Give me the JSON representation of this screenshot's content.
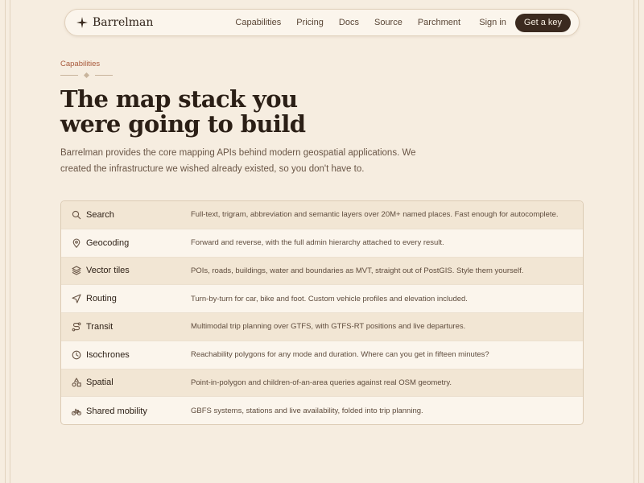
{
  "nav": {
    "brand": "Barrelman",
    "links": [
      "Capabilities",
      "Pricing",
      "Docs",
      "Source",
      "Parchment"
    ],
    "signin": "Sign in",
    "cta": "Get a key"
  },
  "hero": {
    "eyebrow": "Capabilities",
    "title_lines": [
      "The map stack you",
      "were going to build"
    ],
    "subtitle": "Barrelman provides the core mapping APIs behind modern geospatial applications. We created the infrastructure we wished already existed, so you don't have to."
  },
  "capabilities": [
    {
      "icon": "search-icon",
      "name": "Search",
      "desc": "Full-text, trigram, abbreviation and semantic layers over 20M+ named places. Fast enough for autocomplete."
    },
    {
      "icon": "map-pin-icon",
      "name": "Geocoding",
      "desc": "Forward and reverse, with the full admin hierarchy attached to every result."
    },
    {
      "icon": "layers-icon",
      "name": "Vector tiles",
      "desc": "POIs, roads, buildings, water and boundaries as MVT, straight out of PostGIS. Style them yourself."
    },
    {
      "icon": "navigation-arrow-icon",
      "name": "Routing",
      "desc": "Turn-by-turn for car, bike and foot. Custom vehicle profiles and elevation included."
    },
    {
      "icon": "route-icon",
      "name": "Transit",
      "desc": "Multimodal trip planning over GTFS, with GTFS-RT positions and live departures."
    },
    {
      "icon": "clock-icon",
      "name": "Isochrones",
      "desc": "Reachability polygons for any mode and duration. Where can you get in fifteen minutes?"
    },
    {
      "icon": "shapes-icon",
      "name": "Spatial",
      "desc": "Point-in-polygon and children-of-an-area queries against real OSM geometry."
    },
    {
      "icon": "bike-icon",
      "name": "Shared mobility",
      "desc": "GBFS systems, stations and live availability, folded into trip planning."
    }
  ]
}
